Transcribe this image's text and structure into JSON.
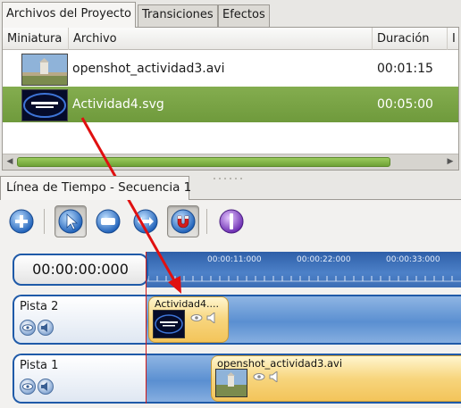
{
  "project_tabs": [
    {
      "label": "Archivos del Proyecto",
      "active": true
    },
    {
      "label": "Transiciones",
      "active": false
    },
    {
      "label": "Efectos",
      "active": false
    }
  ],
  "files_table": {
    "columns": [
      "Miniatura",
      "Archivo",
      "Duración",
      "I"
    ],
    "rows": [
      {
        "file": "openshot_actividad3.avi",
        "duration": "00:01:15",
        "selected": false,
        "thumb": "landscape"
      },
      {
        "file": "Actividad4.svg",
        "duration": "00:05:00",
        "selected": true,
        "thumb": "title-card"
      }
    ]
  },
  "timeline": {
    "tab_label": "Línea de Tiempo - Secuencia 1",
    "timecode": "00:00:00:000",
    "ruler_labels": [
      "00:00:11:000",
      "00:00:22:000",
      "00:00:33:000"
    ],
    "tools": [
      {
        "name": "add-track-icon",
        "pressed": false
      },
      {
        "name": "select-pointer-icon",
        "pressed": true
      },
      {
        "name": "razor-icon",
        "pressed": false
      },
      {
        "name": "resize-icon",
        "pressed": false
      },
      {
        "name": "snap-magnet-icon",
        "pressed": true
      },
      {
        "name": "add-marker-icon",
        "pressed": false
      }
    ],
    "tracks": [
      {
        "name": "Pista 2",
        "clips": [
          {
            "title": "Actividad4....",
            "thumb": "title-card"
          }
        ]
      },
      {
        "name": "Pista 1",
        "clips": [
          {
            "title": "openshot_actividad3.avi",
            "thumb": "landscape"
          }
        ]
      }
    ]
  },
  "colors": {
    "selection_green": "#77a342",
    "timeline_blue": "#1f5aa8",
    "clip_yellow": "#f7d57d",
    "playhead_red": "#d01818",
    "annotation_arrow": "#e01010"
  }
}
